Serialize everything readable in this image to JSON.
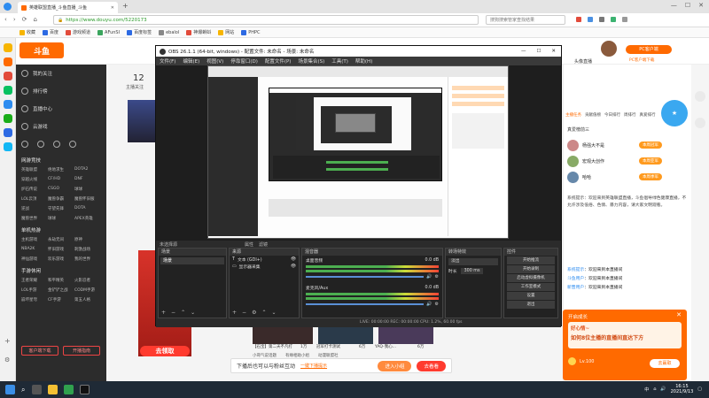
{
  "browser": {
    "tab_title": "英雄联盟直播_斗鱼直播_斗鱼",
    "url": "https://www.douyu.com/5220173",
    "search_placeholder": "搜狗搜索管家查找结果",
    "bookmarks": [
      "收藏",
      "百度",
      "游戏频道",
      "AFunSI",
      "百度标签",
      "ebalol",
      "神爆蝌蚪",
      "网站",
      "PHPC"
    ]
  },
  "douyu": {
    "logo": "斗鱼",
    "follow_count": "12",
    "follow_label": "主播关注",
    "nav": {
      "items": [
        "我的关注",
        "排行榜",
        "直播中心",
        "云游戏"
      ],
      "sec1": "网游竞技",
      "sec1_games": [
        "英雄联盟",
        "绝地求生",
        "DOTA2",
        "穿越火线",
        "CF/HD",
        "DNF",
        "炉石传说",
        "CSGO",
        "球球",
        "LOL云顶",
        "魔兽争霸",
        "魔兽怀旧服",
        "逆战",
        "守望先锋",
        "DOTA",
        "魔兽世界",
        "球球",
        "APEX英雄"
      ],
      "sec2": "单机热游",
      "sec2_games": [
        "主机游戏",
        "永劫无间",
        "原神",
        "NBA2K",
        "怀旧游戏",
        "刺激战场",
        "神仙游戏",
        "欢乐游戏",
        "我的世界"
      ],
      "sec3": "手游休闲",
      "sec3_games": [
        "王者荣耀",
        "和平精英",
        "火影忍者",
        "LOL手游",
        "金铲铲之战",
        "CODM手游",
        "崩坏星穹",
        "CF手游",
        "第五人格"
      ],
      "btn_client": "客户端下载",
      "btn_live": "开播指南"
    },
    "header_right": {
      "live_label": "头像直播",
      "pc_btn": "PC客户端",
      "pc_sub": "PC客户端下载"
    },
    "rank_tabs": [
      "主播任务",
      "贡献值榜",
      "今日排行",
      "周排行",
      "真爱排行"
    ],
    "rank_title": "真爱榜前三",
    "ranks": [
      {
        "name": "杨强大不是",
        "tag": "本周冠军"
      },
      {
        "name": "宏观大创作",
        "tag": "本周亚军"
      },
      {
        "name": "哈哈",
        "tag": "本周季军"
      }
    ],
    "chat_sys": "系统提示：欢迎来到英雄联盟直播，斗鱼倡导绿色健康直播，不允许涉及低俗、色情、暴力内容，请大家文明观看。",
    "chat_lines": [
      {
        "user": "系统提示",
        "msg": "欢迎来到本直播间"
      },
      {
        "user": "斗鱼用户",
        "msg": "欢迎来到本直播间"
      },
      {
        "user": "新晋用户",
        "msg": "欢迎来到本直播间"
      }
    ],
    "popup_title": "开启成长",
    "popup_sub": "好心情~",
    "popup_text": "如何8位主播的直播间直达下方",
    "popup_btn": "去赢取",
    "gift_level": "Lv.100",
    "notif_text": "下播后也可以与粉丝互动",
    "notif_link": "一键下播提示",
    "notif_btn1": "进入小组",
    "notif_btn2": "去看看",
    "bottom_banner": "去领取",
    "shows": [
      {
        "title": "【石宝】第二天不凡打",
        "count": "1万"
      },
      {
        "title": "冠军打卡测试",
        "count": "6万"
      },
      {
        "title": "YAQ-我心...",
        "count": "6万"
      }
    ],
    "bottom_tabs": [
      "小哥气说话题",
      "有缘相助小组",
      "动漫联盟社"
    ]
  },
  "obs": {
    "title": "OBS 26.1.1 (64-bit, windows) - 配置文件: 未命名 - 场景: 未命名",
    "menu": [
      "文件(F)",
      "编辑(E)",
      "视图(V)",
      "停靠窗口(D)",
      "配置文件(P)",
      "场景集合(S)",
      "工具(T)",
      "帮助(H)"
    ],
    "status_line": "未选择源",
    "prop_btn": "属性",
    "filter_btn": "滤镜",
    "dock_scene": "场景",
    "scene_item": "场景",
    "dock_source": "来源",
    "sources": [
      "文本 (GDI+)",
      "显示器采集"
    ],
    "dock_mixer": "混音器",
    "mixer_desktop": "桌面音频",
    "mixer_mic": "麦克风/Aux",
    "mixer_desktop_db": "0.0 dB",
    "mixer_mic_db": "0.0 dB",
    "dock_transition": "转场特效",
    "transition_type": "淡出",
    "duration_label": "时长",
    "duration_value": "300 ms",
    "dock_controls": "控件",
    "controls": [
      "开始推流",
      "开始录制",
      "启动虚拟摄像机",
      "工作室模式",
      "设置",
      "退出"
    ],
    "statusbar": "LIVE: 00:00:00   REC: 00:00:00   CPU: 1.2%, 60.00 fps"
  },
  "taskbar": {
    "time": "16:15",
    "date": "2021/9/13",
    "lang": "中"
  },
  "colors": {
    "douyu_orange": "#ff6a00",
    "douyu_nav_bg": "#2c2c2c",
    "obs_bg": "#2b2b2b",
    "taskbar_bg": "#1f2a36",
    "browser_tab_bg": "#e4e4e4"
  }
}
